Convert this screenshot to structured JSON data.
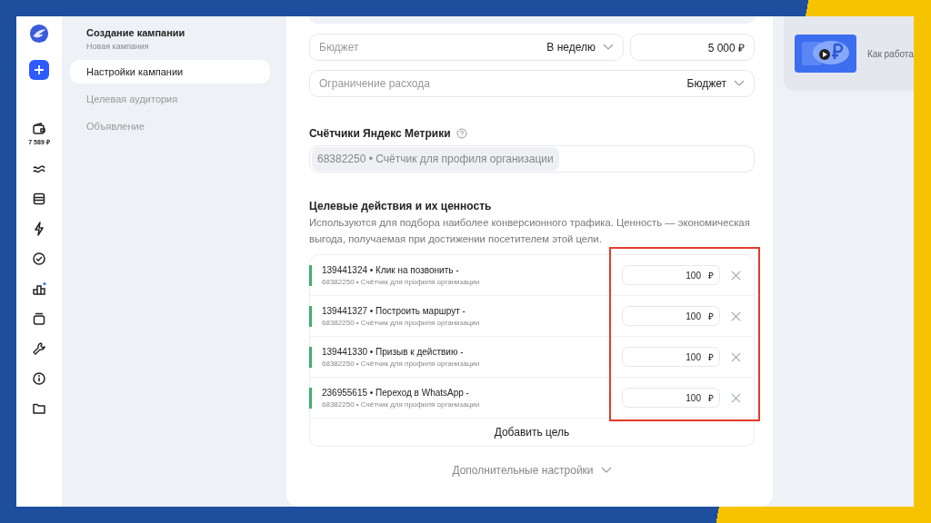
{
  "rail": {
    "balance": "7 589 ₽"
  },
  "nav": {
    "title": "Создание кампании",
    "subtitle": "Новая кампания",
    "items": [
      {
        "label": "Настройки кампании",
        "selected": true
      },
      {
        "label": "Целевая аудитория",
        "selected": false
      },
      {
        "label": "Объявление",
        "selected": false
      }
    ]
  },
  "budget": {
    "placeholder": "Бюджет",
    "period": "В неделю",
    "amount": "5 000 ₽"
  },
  "spend_limit": {
    "placeholder": "Ограничение расхода",
    "value": "Бюджет"
  },
  "metrika": {
    "title": "Счётчики Яндекс Метрики",
    "counter": "68382250 • Счётчик для профиля организации"
  },
  "goals": {
    "title": "Целевые действия и их ценность",
    "description": "Используются для подбора наиболее конверсионного трафика. Ценность — экономическая выгода, получаемая при достижении посетителем этой цели.",
    "items": [
      {
        "name": "139441324 • Клик на позвонить -",
        "counter": "68382250 • Счётчик для профиля организации",
        "value": "100",
        "currency": "₽"
      },
      {
        "name": "139441327 • Построить маршрут -",
        "counter": "68382250 • Счётчик для профиля организации",
        "value": "100",
        "currency": "₽"
      },
      {
        "name": "139441330 • Призыв к действию -",
        "counter": "68382250 • Счётчик для профиля организации",
        "value": "100",
        "currency": "₽"
      },
      {
        "name": "236955615 • Переход в WhatsApp -",
        "counter": "68382250 • Счётчик для профиля организации",
        "value": "100",
        "currency": "₽"
      }
    ],
    "add_button": "Добавить цель"
  },
  "more_settings": "Дополнительные настройки",
  "promo": {
    "text": "Как работа"
  }
}
